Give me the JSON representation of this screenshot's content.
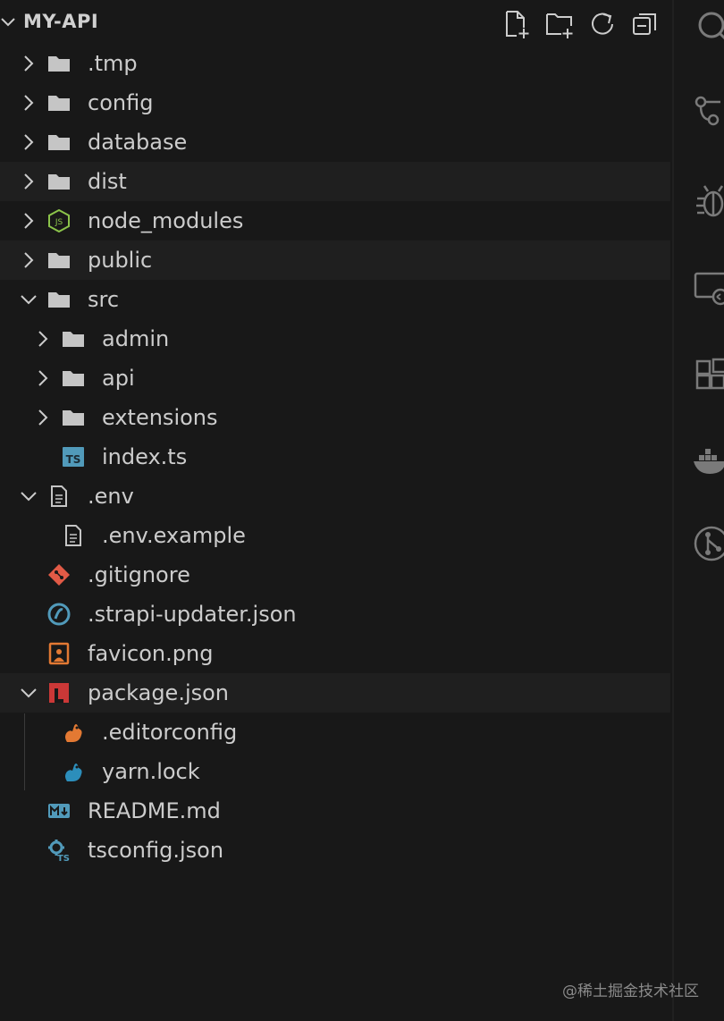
{
  "explorer": {
    "title": "MY-API",
    "toolbar": [
      "new-file-icon",
      "new-folder-icon",
      "refresh-icon",
      "collapse-all-icon"
    ],
    "tree": [
      {
        "label": ".tmp",
        "depth": 0,
        "kind": "folder",
        "expanded": false
      },
      {
        "label": "config",
        "depth": 0,
        "kind": "folder",
        "expanded": false
      },
      {
        "label": "database",
        "depth": 0,
        "kind": "folder",
        "expanded": false
      },
      {
        "label": "dist",
        "depth": 0,
        "kind": "folder",
        "expanded": false,
        "highlight": true
      },
      {
        "label": "node_modules",
        "depth": 0,
        "kind": "node-folder",
        "expanded": false
      },
      {
        "label": "public",
        "depth": 0,
        "kind": "folder",
        "expanded": false,
        "highlight": true
      },
      {
        "label": "src",
        "depth": 0,
        "kind": "folder",
        "expanded": true
      },
      {
        "label": "admin",
        "depth": 1,
        "kind": "folder",
        "expanded": false
      },
      {
        "label": "api",
        "depth": 1,
        "kind": "folder",
        "expanded": false
      },
      {
        "label": "extensions",
        "depth": 1,
        "kind": "folder",
        "expanded": false
      },
      {
        "label": "index.ts",
        "depth": 1,
        "kind": "ts"
      },
      {
        "label": ".env",
        "depth": 0,
        "kind": "doc",
        "expanded": true
      },
      {
        "label": ".env.example",
        "depth": 1,
        "kind": "doc"
      },
      {
        "label": ".gitignore",
        "depth": 0,
        "kind": "git"
      },
      {
        "label": ".strapi-updater.json",
        "depth": 0,
        "kind": "strapi"
      },
      {
        "label": "favicon.png",
        "depth": 0,
        "kind": "image"
      },
      {
        "label": "package.json",
        "depth": 0,
        "kind": "npm",
        "expanded": true,
        "highlight": true
      },
      {
        "label": ".editorconfig",
        "depth": 1,
        "kind": "editorconfig"
      },
      {
        "label": "yarn.lock",
        "depth": 1,
        "kind": "yarn"
      },
      {
        "label": "README.md",
        "depth": 0,
        "kind": "markdown"
      },
      {
        "label": "tsconfig.json",
        "depth": 0,
        "kind": "tsconfig"
      }
    ]
  },
  "activity_bar": [
    "search-icon",
    "source-control-icon",
    "debug-icon",
    "remote-explorer-icon",
    "extensions-icon",
    "docker-icon",
    "git-graph-icon"
  ],
  "watermark": "@稀土掘金技术社区",
  "colors": {
    "background": "#181818",
    "row_highlight": "#1f1f1f",
    "text": "#cccccc",
    "folder": "#c5c5c5",
    "ts": "#519aba",
    "git": "#e15a46",
    "npm": "#cb3837",
    "yarn": "#2c8ebb",
    "image": "#e37933",
    "node": "#8bc34a"
  }
}
